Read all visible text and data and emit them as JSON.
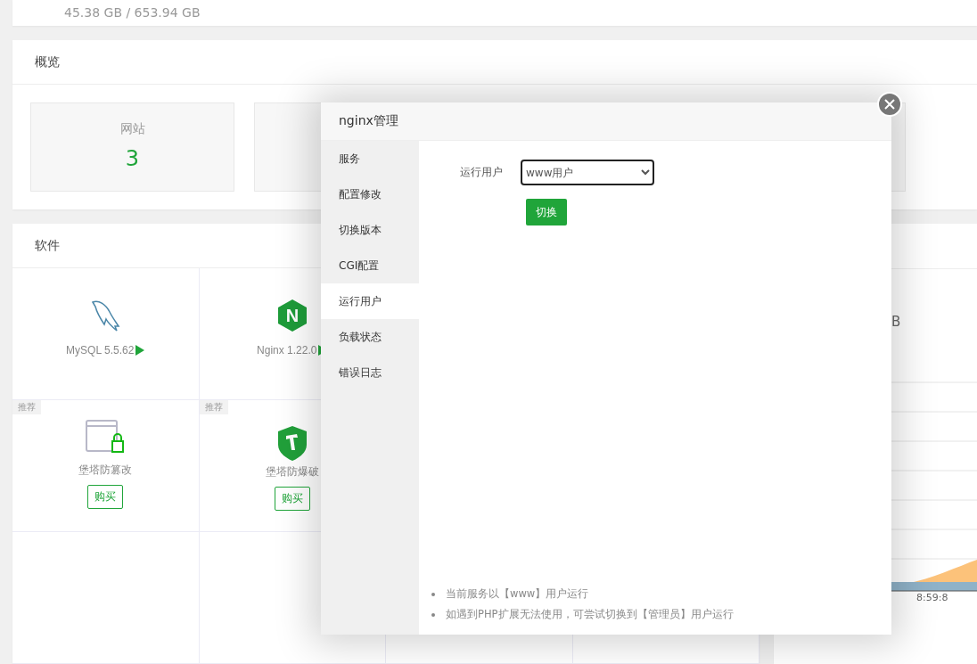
{
  "disk": {
    "usage": "45.38 GB / 653.94 GB"
  },
  "overview": {
    "title": "概览",
    "stats": [
      {
        "label": "网站",
        "value": "3"
      }
    ]
  },
  "software": {
    "title": "软件",
    "installed": [
      {
        "name": "MySQL 5.5.62"
      },
      {
        "logo_letter": "N",
        "name": "Nginx 1.22.0"
      }
    ],
    "recommended": [
      {
        "tag": "推荐",
        "name": "堡塔防篡改",
        "action": "购买"
      },
      {
        "tag": "推荐",
        "name": "堡塔防爆破",
        "action": "购买"
      }
    ]
  },
  "traffic": {
    "reading_fragment": "B",
    "x_labels": [
      "8:59:8"
    ]
  },
  "dialog": {
    "title": "nginx管理",
    "menu": [
      {
        "label": "服务",
        "selected": false
      },
      {
        "label": "配置修改",
        "selected": false
      },
      {
        "label": "切换版本",
        "selected": false
      },
      {
        "label": "CGI配置",
        "selected": false
      },
      {
        "label": "运行用户",
        "selected": true
      },
      {
        "label": "负载状态",
        "selected": false
      },
      {
        "label": "错误日志",
        "selected": false
      }
    ],
    "field_label": "运行用户",
    "select_value": "www用户",
    "button": "切换",
    "notes": [
      "当前服务以【www】用户运行",
      "如遇到PHP扩展无法使用，可尝试切换到【管理员】用户运行"
    ]
  }
}
